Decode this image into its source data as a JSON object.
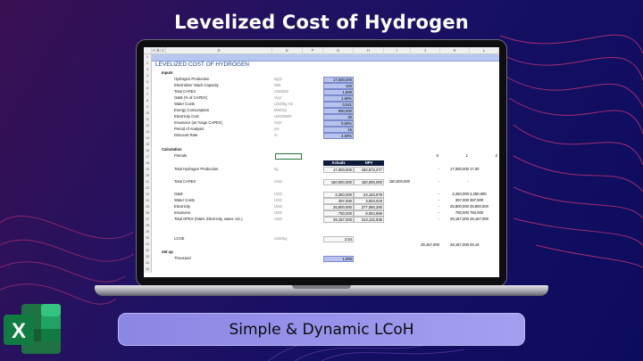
{
  "title": "Levelized Cost of Hydrogen",
  "subtitle": "Simple & Dynamic LCoH",
  "excel_letter": "X",
  "colors": {
    "accent_box": "#b7c3ee",
    "header_dark": "#0e1a3a",
    "excel_green": "#1f7244",
    "pill": "#9b97ee"
  },
  "sheet": {
    "columns": [
      "A",
      "B",
      "C",
      "D",
      "E",
      "F",
      "G",
      "H",
      "I",
      "J",
      "K",
      "L"
    ],
    "heading": "LEVELIZED COST OF HYDROGEN",
    "sections": {
      "inputs": "Inputs",
      "calculation": "Calculation",
      "setup": "Set up"
    },
    "inputs": [
      {
        "label": "Hydrogen Production",
        "unit": "kg/yr",
        "value": "17,000,000"
      },
      {
        "label": "Electrolizer Stack Capacity",
        "unit": "MW",
        "value": "100"
      },
      {
        "label": "Total CAPEX",
        "unit": "USD/kW",
        "value": "1,500"
      },
      {
        "label": "O&M (% of CAPEX)",
        "unit": "%/yr",
        "value": "1.50%"
      },
      {
        "label": "Water Costs",
        "unit": "USD/kg H2",
        "value": "0.021"
      },
      {
        "label": "Energy Consumption",
        "unit": "MWh/yr",
        "value": "860,000"
      },
      {
        "label": "Electricity Cost",
        "unit": "USD/MWh",
        "value": "30"
      },
      {
        "label": "Insurance (as %age CAPEX)",
        "unit": "%/yr",
        "value": "0.50%"
      },
      {
        "label": "Period of Analysis",
        "unit": "yrs",
        "value": "15"
      },
      {
        "label": "Discount Rate",
        "unit": "%",
        "value": "4.50%"
      }
    ],
    "periods_label": "Periods",
    "periods": [
      "0",
      "1",
      "2"
    ],
    "col_headers": {
      "actuals": "Actuals",
      "npv": "NPV"
    },
    "calc_rows": [
      {
        "label": "Total Hydrogen Production",
        "unit": "kg",
        "actuals": "17,000,000",
        "npv": "182,572,277",
        "j": "-",
        "k": "17,000,000",
        "l": "17,00"
      },
      {
        "label": "Total CAPEX",
        "unit": "USD",
        "actuals": "150,000,000",
        "npv": "150,000,000",
        "i": "150,000,000",
        "j": "-",
        "k": "-",
        "l": ""
      },
      {
        "label": "O&M",
        "unit": "USD",
        "actuals": "2,250,000",
        "npv": "24,163,978",
        "j": "-",
        "k": "2,250,000",
        "l": "2,250,000"
      },
      {
        "label": "Water Costs",
        "unit": "USD",
        "actuals": "357,000",
        "npv": "3,834,018",
        "j": "-",
        "k": "357,000",
        "l": "357,000"
      },
      {
        "label": "Electricity",
        "unit": "USD",
        "actuals": "25,800,000",
        "npv": "277,080,280",
        "j": "-",
        "k": "25,800,000",
        "l": "25,800,000"
      },
      {
        "label": "Insurance",
        "unit": "USD",
        "actuals": "750,000",
        "npv": "8,054,659",
        "j": "-",
        "k": "750,000",
        "l": "750,000"
      },
      {
        "label": "Total OPEX (O&M, Electricity, water, etc.)",
        "unit": "USD",
        "actuals": "29,157,000",
        "npv": "313,132,935",
        "j": "-",
        "k": "29,157,000",
        "l": "29,157,000"
      }
    ],
    "lcoe": {
      "label": "LCOE",
      "unit": "USD/kg",
      "value": "2.54"
    },
    "total_row": {
      "k": "29,157,000",
      "l": "29,157,000",
      "m": "29,15"
    },
    "thousand": {
      "label": "Thousand",
      "value": "1,000"
    }
  }
}
